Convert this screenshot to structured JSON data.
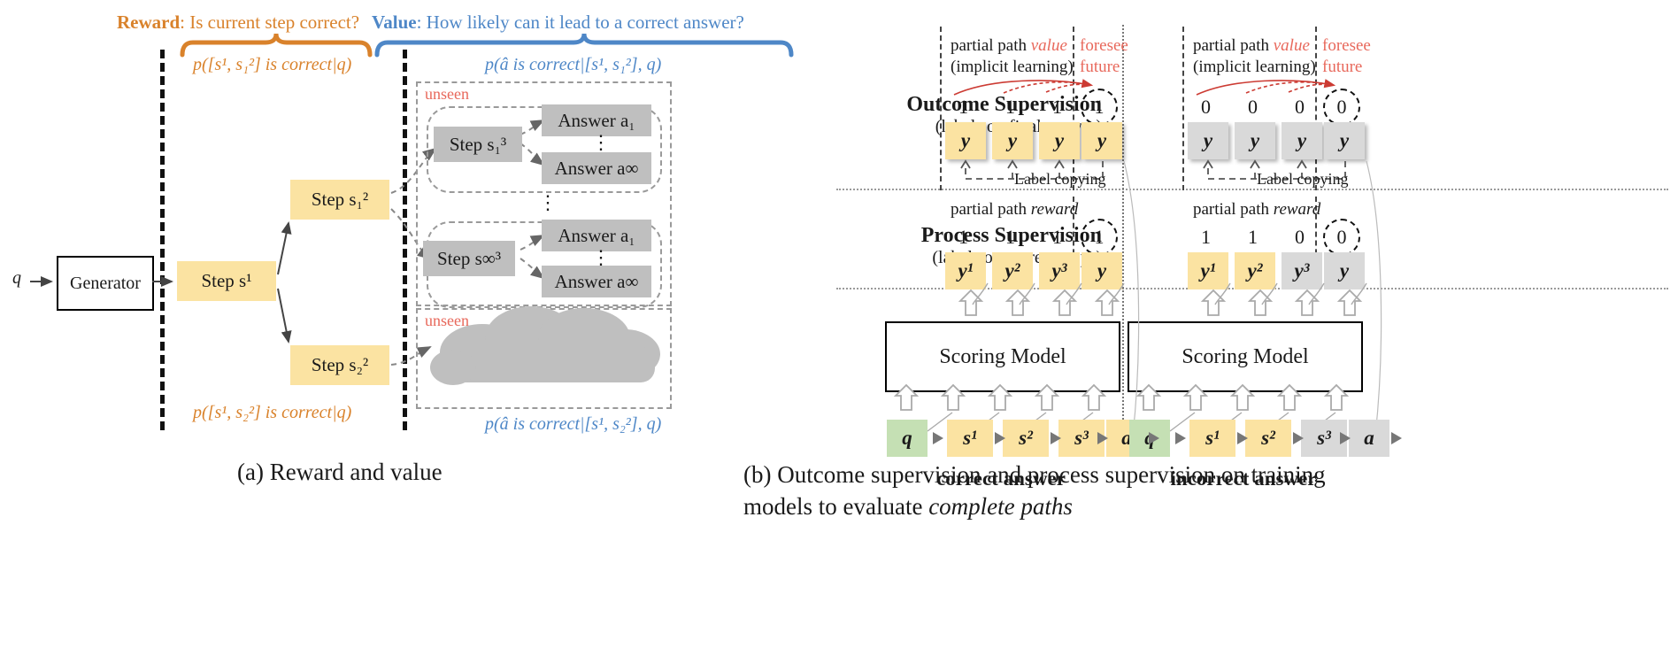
{
  "figure": {
    "panel_a": {
      "top_labels": {
        "reward_key": "Reward",
        "reward_text": ": Is current step correct?",
        "value_key": "Value",
        "value_text": ": How likely can it lead to a correct answer?"
      },
      "formulas": {
        "reward_top": "p([s¹, s₁²] is correct|q)",
        "value_top": "p(â is correct|[s¹, s₁²], q)",
        "reward_bottom": "p([s¹, s₂²] is correct|q)",
        "value_bottom": "p(â is correct|[s¹, s₂²], q)"
      },
      "generator_label": "Generator",
      "query_label": "q",
      "nodes": {
        "step_s1": "Step s¹",
        "step_s1_2": "Step s₁²",
        "step_s2_2": "Step s₂²",
        "step_s1_3": "Step s₁³",
        "step_sinf_3": "Step s∞³",
        "answer_a1_top": "Answer a₁",
        "answer_ainf_top": "Answer a∞",
        "answer_a1_bot": "Answer a₁",
        "answer_ainf_bot": "Answer a∞"
      },
      "unseen_top": "unseen",
      "unseen_bottom": "unseen",
      "vdots": "⋮",
      "caption": "(a)  Reward and value"
    },
    "panel_b": {
      "rows": [
        {
          "title": "Outcome Supervision",
          "subtitle": "(labels on current steps)",
          "note_line1_a": "partial path ",
          "note_line1_b": "value",
          "note_line2": "(implicit learning)",
          "foresee_line1": "foresee",
          "foresee_line2": "future",
          "label_copying": "Label copying"
        },
        {
          "title": "Process Supervision",
          "subtitle": "(labels on current steps)",
          "note_line1_a": "partial path ",
          "note_line1_b": "reward"
        }
      ],
      "outcome": {
        "title": "Outcome Supervision",
        "subtitle": "(labels on final answer)",
        "note_a": "partial path ",
        "note_b": "value",
        "note_c": "(implicit learning)",
        "foresee_a": "foresee",
        "foresee_b": "future",
        "label_copying": "Label copying",
        "correct": {
          "values": [
            "1",
            "1",
            "1",
            "1"
          ],
          "boxes": [
            "y",
            "y",
            "y",
            "y"
          ]
        },
        "incorrect": {
          "values": [
            "0",
            "0",
            "0",
            "0"
          ],
          "boxes": [
            "y",
            "y",
            "y",
            "y"
          ]
        }
      },
      "process": {
        "title": "Process Supervision",
        "subtitle": "(labels on current steps)",
        "note_a": "partial path ",
        "note_b": "reward",
        "correct": {
          "values": [
            "1",
            "1",
            "1",
            "1"
          ],
          "boxes": [
            "y¹",
            "y²",
            "y³",
            "y"
          ]
        },
        "incorrect": {
          "values": [
            "1",
            "1",
            "0",
            "0"
          ],
          "boxes": [
            "y¹",
            "y²",
            "y³",
            "y"
          ]
        }
      },
      "scoring_model_label": "Scoring Model",
      "tokens_correct": [
        "q",
        "s¹",
        "s²",
        "s³",
        "a"
      ],
      "tokens_incorrect": [
        "q",
        "s¹",
        "s²",
        "s³",
        "a"
      ],
      "bottom_label_left": "correct answer",
      "bottom_label_right": "incorrect answer",
      "caption_line1": "(b)  Outcome supervision and process supervision on training",
      "caption_line2_a": "models to evaluate ",
      "caption_line2_b": "complete paths"
    }
  },
  "colors": {
    "orange": "#d9822b",
    "blue": "#4e87c7",
    "red": "#e8685b",
    "yellow": "#fbe3a2",
    "gray": "#bfbfbf",
    "green": "#c5e0b4",
    "light_gray": "#d9d9d9"
  }
}
